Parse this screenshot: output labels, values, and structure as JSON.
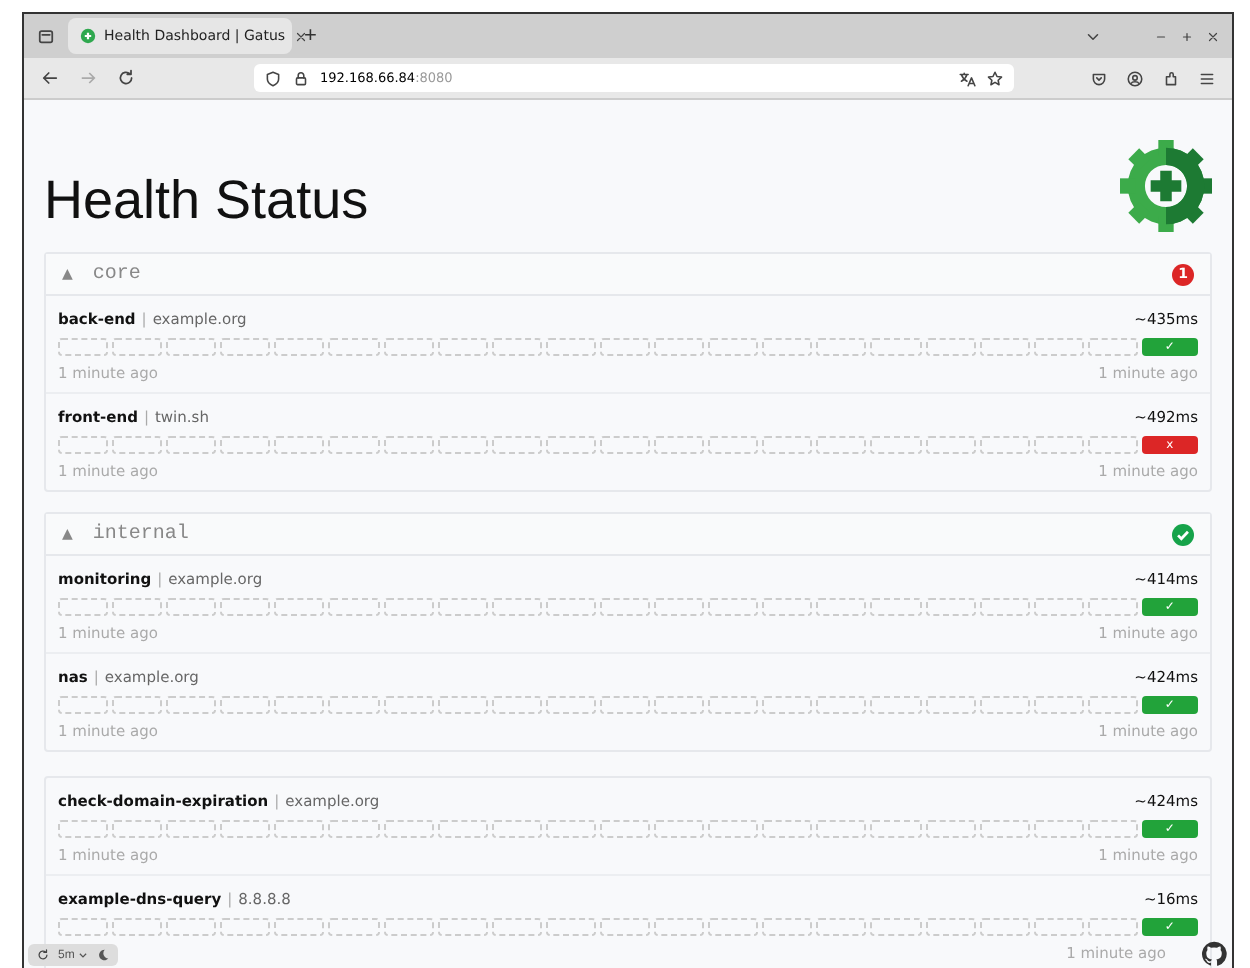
{
  "browser": {
    "tab_title": "Health Dashboard | Gatus",
    "new_tab": "+",
    "url_host": "192.168.66.84",
    "url_port": ":8080"
  },
  "page": {
    "title": "Health Status"
  },
  "groups": [
    {
      "name": "core",
      "toggle": "▲",
      "status": {
        "kind": "failures",
        "count": "1"
      },
      "endpoints": [
        {
          "name": "back-end",
          "separator": "|",
          "host": "example.org",
          "response_time": "~435ms",
          "success": true,
          "symbol": "✓",
          "oldest": "1 minute ago",
          "newest": "1 minute ago"
        },
        {
          "name": "front-end",
          "separator": "|",
          "host": "twin.sh",
          "response_time": "~492ms",
          "success": false,
          "symbol": "x",
          "oldest": "1 minute ago",
          "newest": "1 minute ago"
        }
      ]
    },
    {
      "name": "internal",
      "toggle": "▲",
      "status": {
        "kind": "healthy"
      },
      "endpoints": [
        {
          "name": "monitoring",
          "separator": "|",
          "host": "example.org",
          "response_time": "~414ms",
          "success": true,
          "symbol": "✓",
          "oldest": "1 minute ago",
          "newest": "1 minute ago"
        },
        {
          "name": "nas",
          "separator": "|",
          "host": "example.org",
          "response_time": "~424ms",
          "success": true,
          "symbol": "✓",
          "oldest": "1 minute ago",
          "newest": "1 minute ago"
        }
      ]
    }
  ],
  "ungrouped_endpoints": [
    {
      "name": "check-domain-expiration",
      "separator": "|",
      "host": "example.org",
      "response_time": "~424ms",
      "success": true,
      "symbol": "✓",
      "oldest": "1 minute ago",
      "newest": "1 minute ago"
    },
    {
      "name": "example-dns-query",
      "separator": "|",
      "host": "8.8.8.8",
      "response_time": "~16ms",
      "success": true,
      "symbol": "✓",
      "newest": "1 minute ago"
    }
  ],
  "settings": {
    "refresh_interval": "5m"
  }
}
